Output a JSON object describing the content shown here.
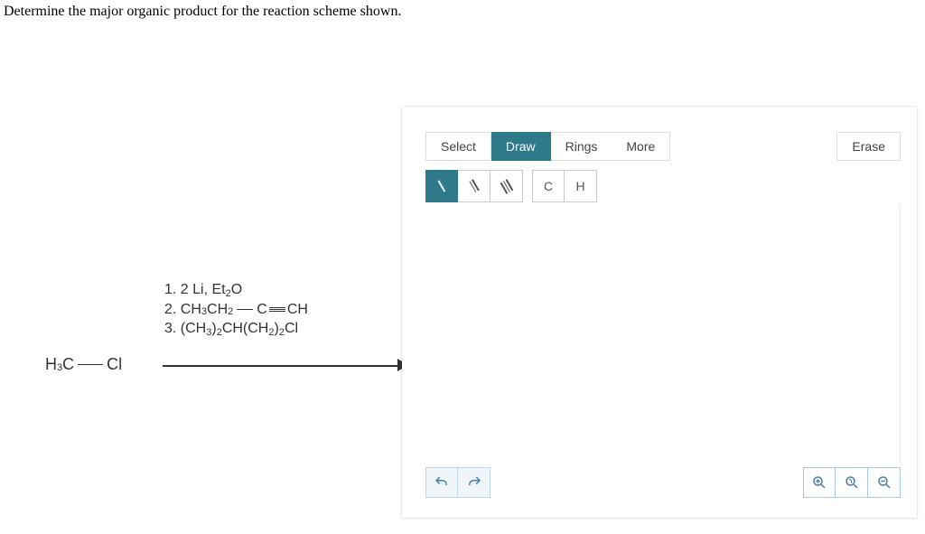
{
  "question": "Determine the major organic product for the reaction scheme shown.",
  "substrate": {
    "left": "H",
    "leftSub": "3",
    "leftAtom": "C",
    "right": "Cl"
  },
  "reagents": {
    "line1": {
      "prefix": "1. 2 Li, Et",
      "sub": "2",
      "suffix": "O"
    },
    "line2": {
      "prefix": "2.  CH",
      "sub1": "3",
      "mid": "CH",
      "sub2": "2",
      "c": "C",
      "ch": "CH"
    },
    "line3": {
      "prefix": "3. (CH",
      "s1": "3",
      "m1": ")",
      "s2": "2",
      "m2": "CH(CH",
      "s3": "2",
      "m3": ")",
      "s4": "2",
      "suffix": "Cl"
    }
  },
  "editor": {
    "tabs": {
      "select": "Select",
      "draw": "Draw",
      "rings": "Rings",
      "more": "More",
      "erase": "Erase"
    },
    "atoms": {
      "c": "C",
      "h": "H"
    }
  }
}
